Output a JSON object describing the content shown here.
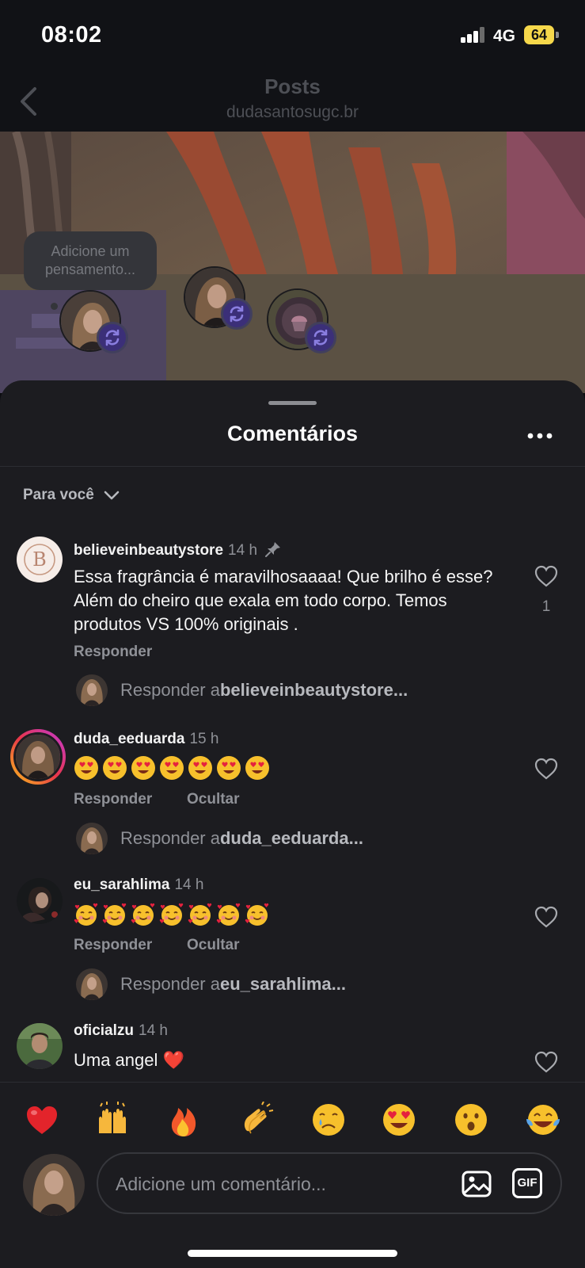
{
  "status_bar": {
    "time": "08:02",
    "network": "4G",
    "battery": "64"
  },
  "header": {
    "title": "Posts",
    "subtitle": "dudasantosugc.br"
  },
  "story": {
    "thought_placeholder": "Adicione um pensamento..."
  },
  "sheet": {
    "title": "Comentários",
    "filter_label": "Para você"
  },
  "comments": [
    {
      "username": "believeinbeautystore",
      "time": "14 h",
      "text": "Essa fragrância é maravilhosaaaa! Que brilho é esse? Além do cheiro que exala em todo corpo. Temos produtos VS 100% originais .",
      "reply_label": "Responder",
      "likes": "1",
      "reply_prompt": "Responder a ",
      "reply_target": "believeinbeautystore..."
    },
    {
      "username": "duda_eeduarda",
      "time": "15 h",
      "emoji": "heart-eyes",
      "reply_label": "Responder",
      "hide_label": "Ocultar",
      "reply_prompt": "Responder a ",
      "reply_target": "duda_eeduarda..."
    },
    {
      "username": "eu_sarahlima",
      "time": "14 h",
      "emoji": "smiling-face-with-hearts",
      "reply_label": "Responder",
      "hide_label": "Ocultar",
      "reply_prompt": "Responder a ",
      "reply_target": "eu_sarahlima..."
    },
    {
      "username": "oficialzu",
      "time": "14 h",
      "text": "Uma angel ❤️"
    }
  ],
  "reactions": [
    "❤️",
    "🙌",
    "🔥",
    "👏",
    "😢",
    "😍",
    "😮",
    "😂"
  ],
  "composer": {
    "placeholder": "Adicione um comentário...",
    "gif_label": "GIF"
  },
  "colors": {
    "sheet_bg": "#1c1c20",
    "story_ring_start": "#f9c11a",
    "story_ring_end": "#c33ad6",
    "repost_badge": "#3b2f78"
  }
}
